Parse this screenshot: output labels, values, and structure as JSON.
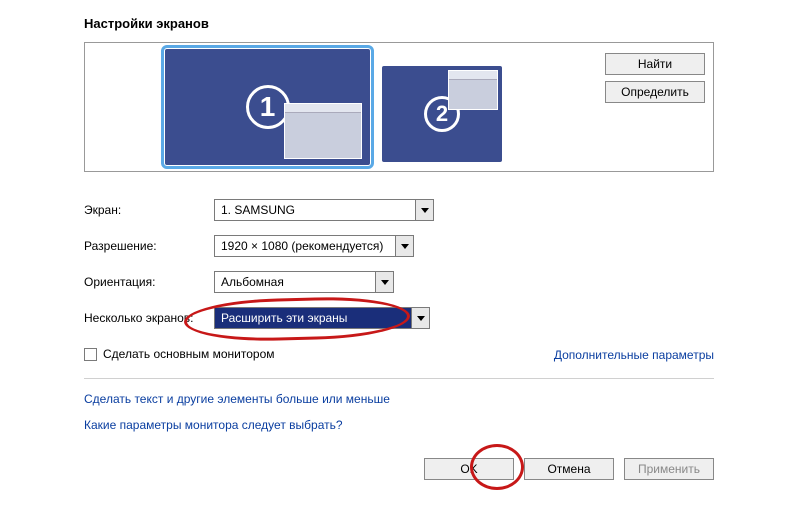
{
  "title": "Настройки экранов",
  "monitors": {
    "primary_num": "1",
    "secondary_num": "2"
  },
  "side_buttons": {
    "find": "Найти",
    "identify": "Определить"
  },
  "fields": {
    "screen": {
      "label": "Экран:",
      "value": "1. SAMSUNG"
    },
    "resolution": {
      "label": "Разрешение:",
      "value": "1920 × 1080 (рекомендуется)"
    },
    "orientation": {
      "label": "Ориентация:",
      "value": "Альбомная"
    },
    "multiple": {
      "label": "Несколько экранов:",
      "value": "Расширить эти экраны"
    }
  },
  "checkbox": {
    "label": "Сделать основным монитором",
    "checked": false
  },
  "advanced_link": "Дополнительные параметры",
  "links": {
    "text_size": "Сделать текст и другие элементы больше или меньше",
    "help": "Какие параметры монитора следует выбрать?"
  },
  "buttons": {
    "ok": "OK",
    "cancel": "Отмена",
    "apply": "Применить"
  }
}
